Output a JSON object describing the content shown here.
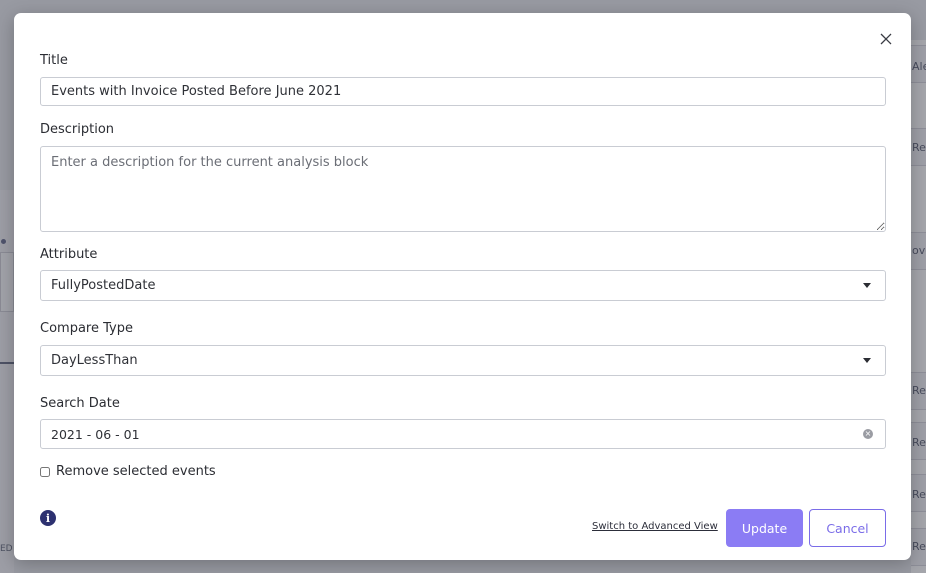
{
  "background": {
    "right_snippets": [
      "Aler",
      "Re",
      "ove",
      "Re",
      "Re",
      "Re",
      "Re"
    ],
    "left_snippet": "ED"
  },
  "modal": {
    "title_label": "Title",
    "title_value": "Events with Invoice Posted Before June 2021",
    "description_label": "Description",
    "description_placeholder": "Enter a description for the current analysis block",
    "description_value": "",
    "attribute_label": "Attribute",
    "attribute_value": "FullyPostedDate",
    "compare_type_label": "Compare Type",
    "compare_type_value": "DayLessThan",
    "search_date_label": "Search Date",
    "search_date_value": "2021 - 06 - 01",
    "remove_selected_label": "Remove selected events",
    "remove_selected_checked": false,
    "advanced_link": "Switch to Advanced View",
    "update_label": "Update",
    "cancel_label": "Cancel"
  },
  "colors": {
    "accent": "#8b7cf4",
    "accent_border": "#7a6ce8",
    "info_icon": "#2d3170"
  },
  "icons": {
    "close": "close-icon",
    "dropdown": "caret-down-icon",
    "clear": "clear-icon",
    "info": "info-icon"
  }
}
